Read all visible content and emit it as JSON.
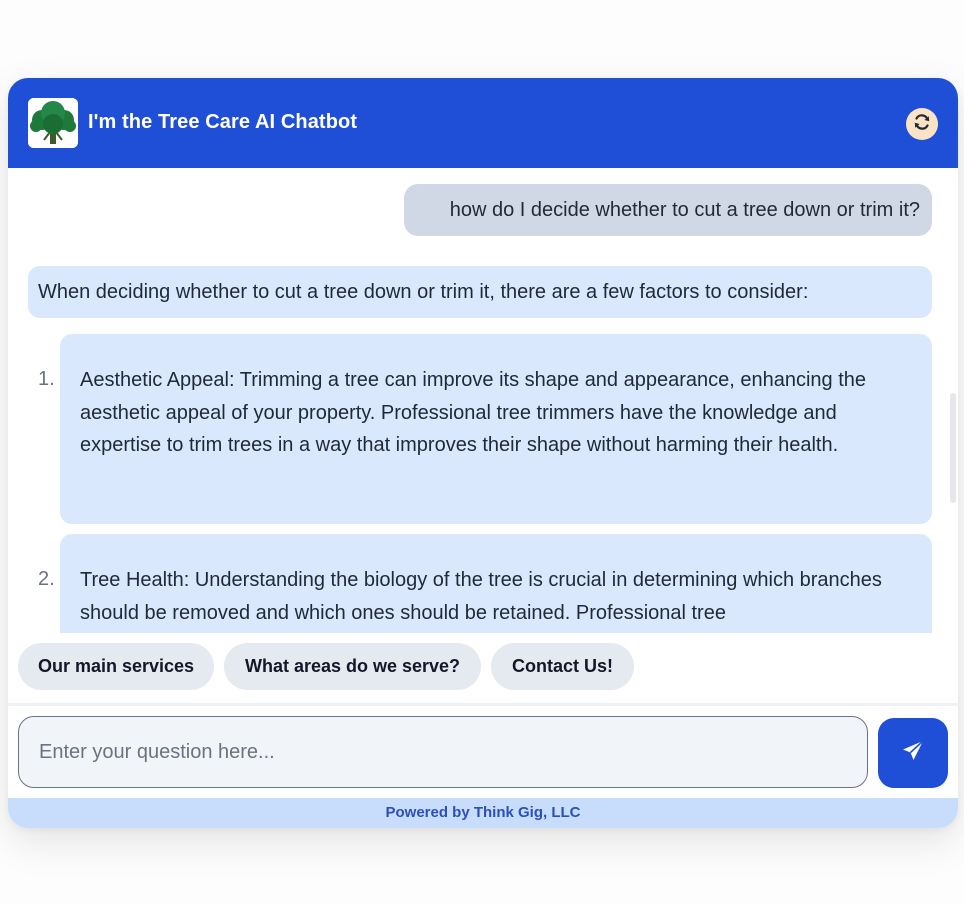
{
  "header": {
    "title": "I'm the Tree Care AI Chatbot",
    "logo_icon": "tree-logo",
    "refresh_icon": "refresh-icon",
    "brand_color": "#1f4fd6"
  },
  "messages": {
    "user_question": "how do I decide whether to cut a tree down or trim it?",
    "bot_intro": "When deciding whether to cut a tree down or trim it, there are a few factors to consider:",
    "items": [
      {
        "number": "1.",
        "text": "Aesthetic Appeal: Trimming a tree can improve its shape and appearance, enhancing the aesthetic appeal of your property. Professional tree trimmers have the knowledge and expertise to trim trees in a way that improves their shape without harming their health."
      },
      {
        "number": "2.",
        "text": "Tree Health: Understanding the biology of the tree is crucial in determining which branches should be removed and which ones should be retained. Professional tree"
      }
    ]
  },
  "quick_replies": [
    "Our main services",
    "What areas do we serve?",
    "Contact Us!"
  ],
  "input": {
    "placeholder": "Enter your question here...",
    "value": "",
    "send_icon": "send-icon"
  },
  "footer": {
    "text": "Powered by Think Gig, LLC"
  }
}
